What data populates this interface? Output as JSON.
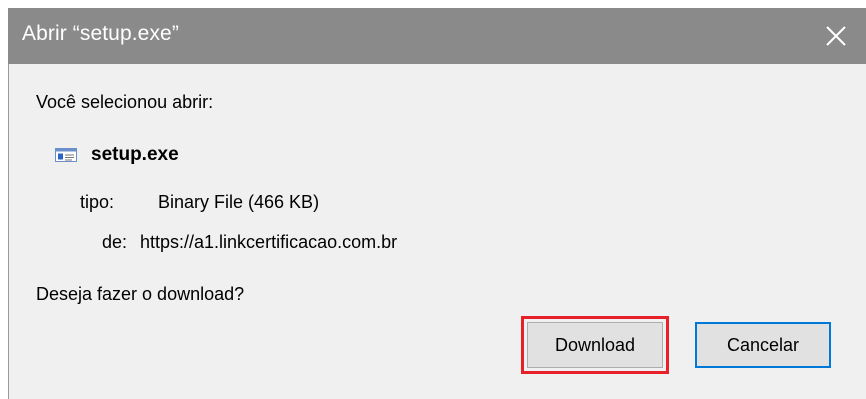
{
  "window": {
    "title": "Abrir “setup.exe”",
    "close_symbol": "✕"
  },
  "dialog": {
    "prompt": "Você selecionou abrir:",
    "file_name": "setup.exe",
    "file_icon": "exe-file-icon",
    "type_label": "tipo:",
    "type_value": "Binary File (466 KB)",
    "from_label": "de:",
    "from_value": "https://a1.linkcertificacao.com.br",
    "question": "Deseja fazer o download?"
  },
  "buttons": {
    "download": "Download",
    "cancel": "Cancelar"
  },
  "colors": {
    "titlebar": "#8a8a8a",
    "highlight": "#e8202a",
    "focus": "#0078d7"
  }
}
